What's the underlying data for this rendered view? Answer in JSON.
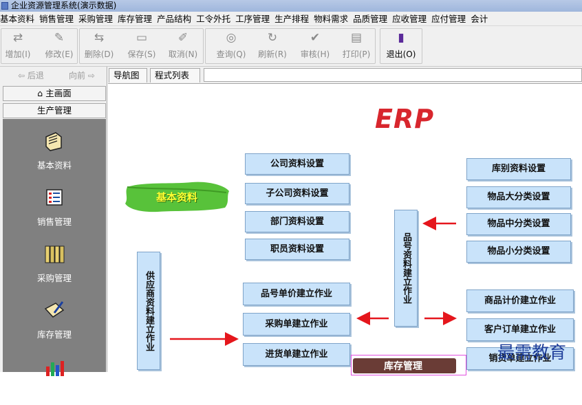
{
  "window": {
    "title": "企业资源管理系统(演示数据)"
  },
  "menu": [
    "基本资料",
    "销售管理",
    "采购管理",
    "库存管理",
    "产品结构",
    "工令外托",
    "工序管理",
    "生产排程",
    "物料需求",
    "品质管理",
    "应收管理",
    "应付管理",
    "会计"
  ],
  "toolbar": {
    "buttons": [
      {
        "label": "增加(I)",
        "icon": "add-icon",
        "enabled": false
      },
      {
        "label": "修改(E)",
        "icon": "edit-icon",
        "enabled": false
      },
      {
        "label": "删除(D)",
        "icon": "delete-icon",
        "enabled": false
      },
      {
        "label": "保存(S)",
        "icon": "save-icon",
        "enabled": false
      },
      {
        "label": "取消(N)",
        "icon": "cancel-icon",
        "enabled": false
      },
      {
        "label": "查询(Q)",
        "icon": "binoculars-icon",
        "enabled": false
      },
      {
        "label": "刷新(R)",
        "icon": "refresh-icon",
        "enabled": false
      },
      {
        "label": "审核(H)",
        "icon": "check-icon",
        "enabled": false
      },
      {
        "label": "打印(P)",
        "icon": "printer-icon",
        "enabled": false
      },
      {
        "label": "退出(O)",
        "icon": "exit-icon",
        "enabled": true
      }
    ]
  },
  "nav": {
    "back": "后退",
    "forward": "向前",
    "home": "主画面",
    "section": "生产管理"
  },
  "modules": [
    {
      "label": "基本资料",
      "icon": "folder-icon"
    },
    {
      "label": "销售管理",
      "icon": "list-icon"
    },
    {
      "label": "采购管理",
      "icon": "binders-icon"
    },
    {
      "label": "库存管理",
      "icon": "notebook-icon"
    },
    {
      "label": "",
      "icon": "chart-icon"
    }
  ],
  "tabs": [
    "导航图",
    "程式列表"
  ],
  "diagram": {
    "logo": "ERP",
    "basic_label": "基本资料",
    "col1": [
      "公司资料设置",
      "子公司资料设置",
      "部门资料设置",
      "职员资料设置"
    ],
    "col2": [
      "品号单价建立作业",
      "采购单建立作业",
      "进货单建立作业"
    ],
    "supplier_box": "供应商资料建立作业",
    "item_box": "品号资料建立作业",
    "col3": [
      "库别资料设置",
      "物品大分类设置",
      "物品中分类设置",
      "物品小分类设置"
    ],
    "col4": [
      "商品计价建立作业",
      "客户订单建立作业",
      "销货单建立作业"
    ],
    "stock_label": "库存管理",
    "arrow_color": "#e5161c"
  },
  "watermark": "最需教育"
}
